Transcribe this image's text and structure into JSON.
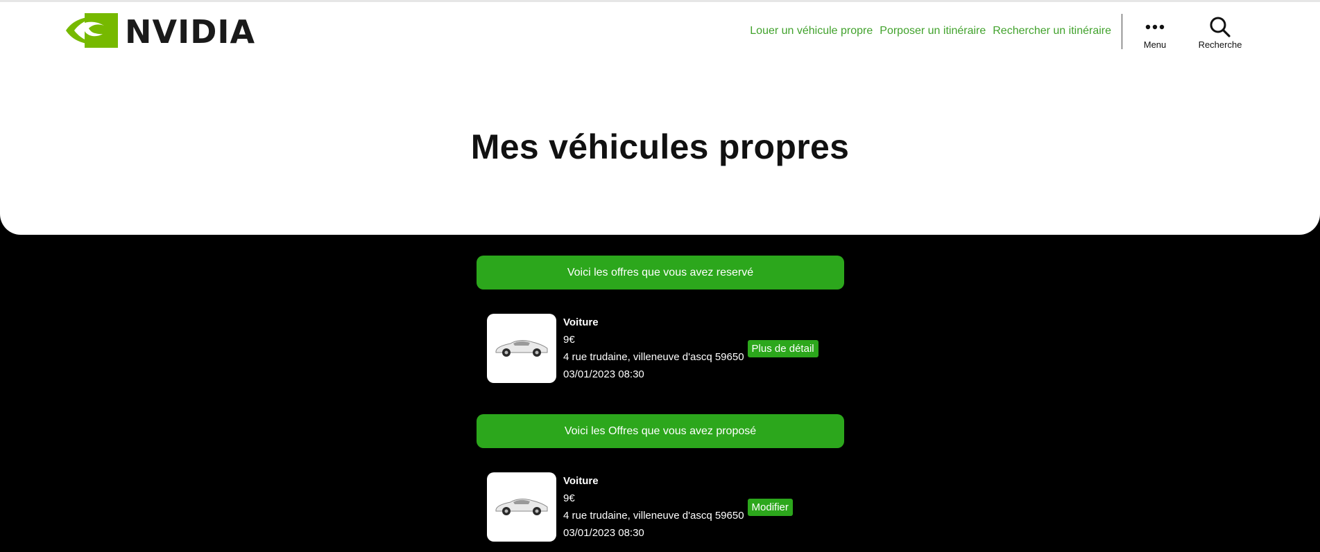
{
  "brand": {
    "name": "NVIDIA",
    "logo_icon": "nvidia-eye-logo-icon",
    "logo_color": "#76b900"
  },
  "nav": {
    "links": [
      "Louer un véhicule propre",
      "Porposer un itinéraire",
      "Rechercher un itinéraire"
    ],
    "menu_label": "Menu",
    "menu_icon": "dots-horizontal-icon",
    "search_label": "Recherche",
    "search_icon": "search-icon",
    "link_color": "#41a22c"
  },
  "page": {
    "title": "Mes véhicules propres"
  },
  "sections": [
    {
      "banner": "Voici les offres que vous avez reservé",
      "offers": [
        {
          "type": "Voiture",
          "price": "9€",
          "address": "4 rue trudaine, villeneuve d'ascq 59650",
          "datetime": "03/01/2023 08:30",
          "action": "Plus de détail",
          "image_icon": "car-icon"
        }
      ]
    },
    {
      "banner": "Voici les Offres que vous avez proposé",
      "offers": [
        {
          "type": "Voiture",
          "price": "9€",
          "address": "4 rue trudaine, villeneuve d'ascq 59650",
          "datetime": "03/01/2023 08:30",
          "action": "Modifier",
          "image_icon": "car-icon"
        }
      ]
    }
  ],
  "colors": {
    "accent": "#2ca71c",
    "background": "#000000",
    "header_bg": "#ffffff"
  }
}
